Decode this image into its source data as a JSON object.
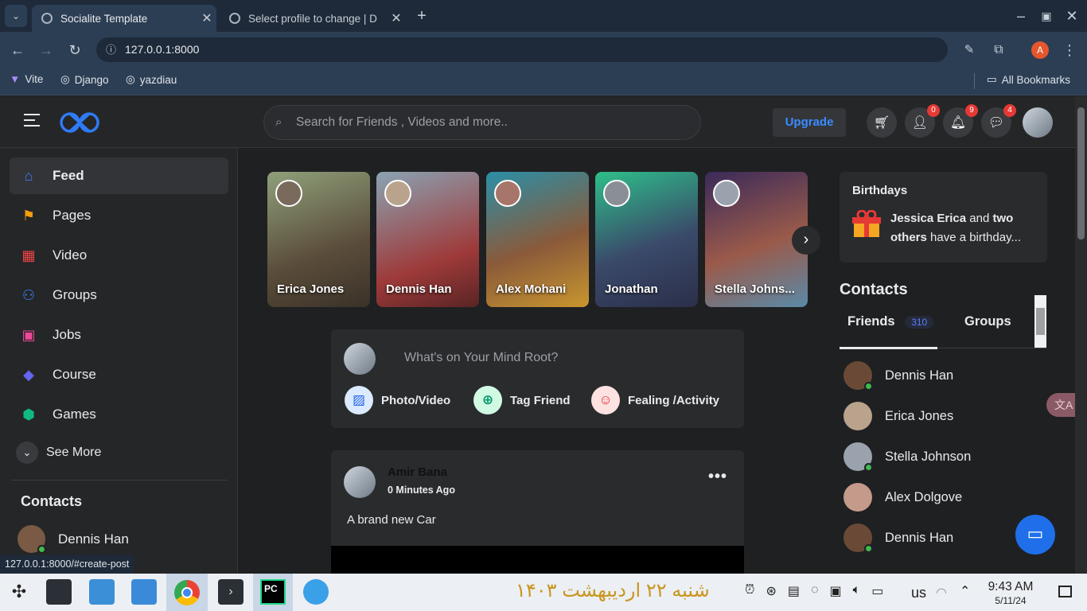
{
  "browser": {
    "tabs": [
      {
        "title": "Socialite Template",
        "active": true
      },
      {
        "title": "Select profile to change | D",
        "active": false
      }
    ],
    "url": "127.0.0.1:8000",
    "profile_initial": "A",
    "bookmarks": [
      "Vite",
      "Django",
      "yazdiau"
    ],
    "all_bookmarks": "All Bookmarks",
    "status_url": "127.0.0.1:8000/#create-post"
  },
  "header": {
    "search_placeholder": "Search for Friends , Videos and more..",
    "upgrade": "Upgrade",
    "badges": {
      "friends": "0",
      "notifications": "9",
      "messages": "4"
    }
  },
  "sidebar": {
    "items": [
      {
        "label": "Feed",
        "icon": "home-icon",
        "color": "#3b82f6"
      },
      {
        "label": "Pages",
        "icon": "flag-icon",
        "color": "#f59e0b"
      },
      {
        "label": "Video",
        "icon": "film-icon",
        "color": "#ef4444"
      },
      {
        "label": "Groups",
        "icon": "people-icon",
        "color": "#3b82f6"
      },
      {
        "label": "Jobs",
        "icon": "briefcase-icon",
        "color": "#ec4899"
      },
      {
        "label": "Course",
        "icon": "graduation-icon",
        "color": "#6366f1"
      },
      {
        "label": "Games",
        "icon": "cube-icon",
        "color": "#10b981"
      }
    ],
    "see_more": "See More",
    "contacts_title": "Contacts",
    "contact": "Dennis Han"
  },
  "stories": [
    "Erica Jones",
    "Dennis Han",
    "Alex Mohani",
    "Jonathan",
    "Stella Johns..."
  ],
  "composer": {
    "placeholder": "What's on Your Mind Root?",
    "actions": [
      "Photo/Video",
      "Tag Friend",
      "Fealing /Activity"
    ]
  },
  "post": {
    "author": "Amir Bana",
    "time": "0 Minutes Ago",
    "text": "A brand new Car"
  },
  "birthdays": {
    "title": "Birthdays",
    "name": "Jessica Erica",
    "and": "and",
    "two_others": "two others",
    "rest": "have a birthday..."
  },
  "contacts_panel": {
    "title": "Contacts",
    "tabs": {
      "friends": "Friends",
      "friends_count": "310",
      "groups": "Groups"
    },
    "people": [
      {
        "name": "Dennis Han",
        "online": true
      },
      {
        "name": "Erica Jones",
        "online": false
      },
      {
        "name": "Stella Johnson",
        "online": true
      },
      {
        "name": "Alex Dolgove",
        "online": false
      },
      {
        "name": "Dennis Han",
        "online": true
      }
    ]
  },
  "taskbar": {
    "date_fa": "شنبه ۲۲ اردیبهشت ۱۴۰۳",
    "lang": "us",
    "time": "9:43 AM",
    "date": "5/11/24"
  }
}
